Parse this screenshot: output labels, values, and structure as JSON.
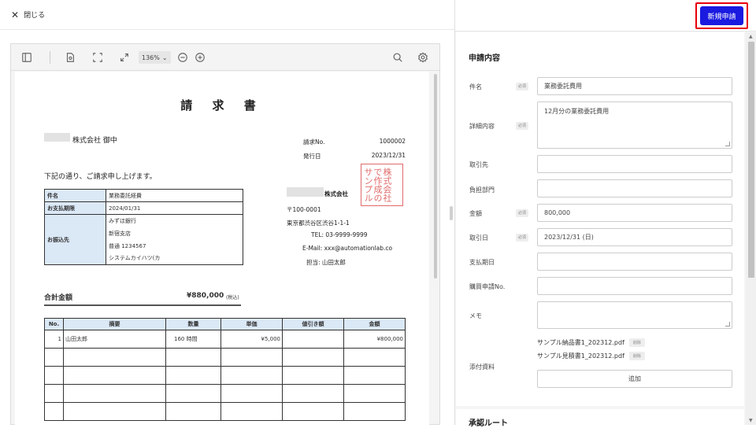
{
  "topbar": {
    "close_label": "閉じる"
  },
  "viewer": {
    "zoom": "136%",
    "document": {
      "title": "請 求 書",
      "recipient_suffix": "株式会社 御中",
      "invoice_no_label": "請求No.",
      "invoice_no": "1000002",
      "issue_date_label": "発行日",
      "issue_date": "2023/12/31",
      "intro": "下記の通り、ご請求申し上げます。",
      "stamp": [
        "サンプル",
        "で作成の",
        "株式会社"
      ],
      "info_rows": [
        {
          "label": "件名",
          "value": "業務委託経費"
        },
        {
          "label": "お支払期限",
          "value": "2024/01/31"
        }
      ],
      "bank": {
        "label": "お振込先",
        "lines": [
          "みずほ銀行",
          "新宿支店",
          "普通 1234567",
          "システムカイハツ(カ"
        ]
      },
      "company": {
        "name_suffix": "株式会社",
        "postal": "〒100-0001",
        "address": "東京都渋谷区渋谷1-1-1",
        "tel": "TEL: 03-9999-9999",
        "email": "E-Mail: xxx@automationlab.co",
        "person": "担当: 山田太郎"
      },
      "total_label": "合計金額",
      "total_value": "¥880,000",
      "total_note": "(税込)",
      "items_headers": [
        "No.",
        "摘要",
        "数量",
        "単価",
        "値引き額",
        "金額"
      ],
      "items": [
        [
          "1",
          "山田太郎",
          "160 時間",
          "¥5,000",
          "",
          "¥800,000"
        ],
        [
          "",
          "",
          "",
          "",
          "",
          ""
        ],
        [
          "",
          "",
          "",
          "",
          "",
          ""
        ],
        [
          "",
          "",
          "",
          "",
          "",
          ""
        ],
        [
          "",
          "",
          "",
          "",
          "",
          ""
        ]
      ]
    }
  },
  "header": {
    "new_request_label": "新規申請"
  },
  "form": {
    "section_title": "申請内容",
    "required_badge": "必須",
    "fields": {
      "subject": {
        "label": "件名",
        "value": "業務委託費用"
      },
      "details": {
        "label": "詳細内容",
        "value": "12月分の業務委託費用"
      },
      "vendor": {
        "label": "取引先",
        "value": ""
      },
      "dept": {
        "label": "負担部門",
        "value": ""
      },
      "amount": {
        "label": "金額",
        "value": "800,000"
      },
      "txn_date": {
        "label": "取引日",
        "value": "2023/12/31 (日)"
      },
      "pay_date": {
        "label": "支払期日",
        "value": ""
      },
      "purchase_no": {
        "label": "購買申請No.",
        "value": ""
      },
      "memo": {
        "label": "メモ",
        "value": ""
      }
    },
    "attachments_label": "添付資料",
    "attachments": [
      "サンプル納品書1_202312.pdf",
      "サンプル見積書1_202312.pdf"
    ],
    "delete_label": "削除",
    "add_label": "追加"
  },
  "route": {
    "title": "承認ルート"
  }
}
